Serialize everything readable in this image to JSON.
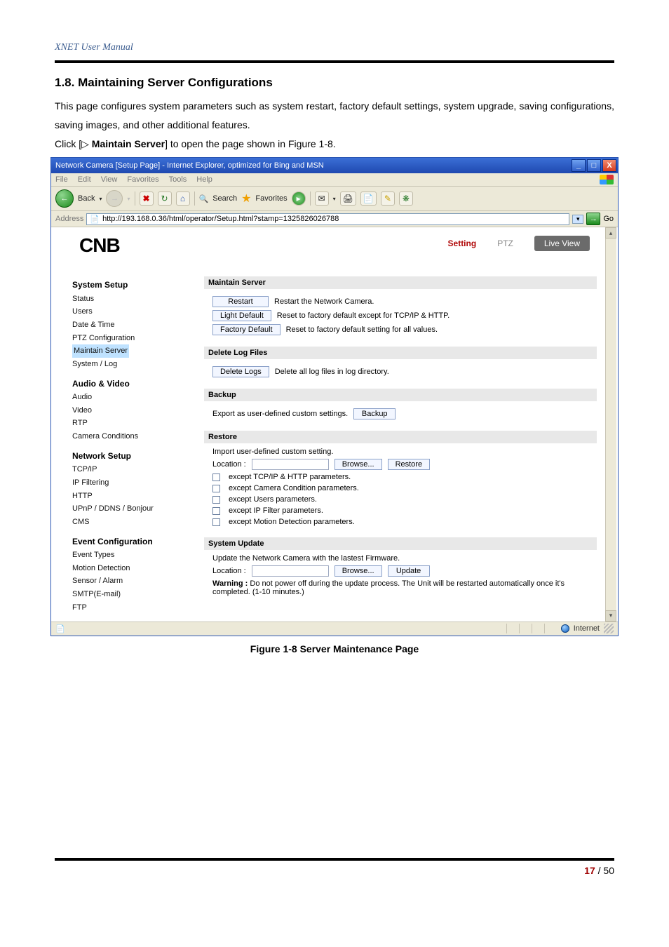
{
  "doc": {
    "manual_title": "XNET User Manual",
    "section_title": "1.8. Maintaining Server Configurations",
    "para1": "This page configures system parameters such as system restart, factory default settings, system upgrade, saving configurations, saving images, and other additional features.",
    "click_prefix": "Click [",
    "click_icon": "▷",
    "click_bold": " Maintain Server",
    "click_suffix": "] to open the page shown in Figure 1-8.",
    "figure_caption": "Figure 1-8 Server Maintenance Page",
    "page_current": "17",
    "page_sep": " / ",
    "page_total": "50"
  },
  "browser": {
    "title": "Network Camera [Setup Page] - Internet Explorer, optimized for Bing and MSN",
    "menu": {
      "file": "File",
      "edit": "Edit",
      "view": "View",
      "favorites": "Favorites",
      "tools": "Tools",
      "help": "Help"
    },
    "toolbar": {
      "back": "Back",
      "search": "Search",
      "favorites": "Favorites"
    },
    "address_label": "Address",
    "url": "http://193.168.0.36/html/operator/Setup.html?stamp=1325826026788",
    "go": "Go",
    "status_zone": "Internet"
  },
  "page": {
    "logo": "CNB",
    "tabs": {
      "setting": "Setting",
      "ptz": "PTZ",
      "live": "Live View"
    },
    "sidebar": {
      "g1": "System Setup",
      "g1_items": [
        "Status",
        "Users",
        "Date & Time",
        "PTZ Configuration",
        "Maintain Server",
        "System / Log"
      ],
      "g2": "Audio & Video",
      "g2_items": [
        "Audio",
        "Video",
        "RTP",
        "Camera Conditions"
      ],
      "g3": "Network Setup",
      "g3_items": [
        "TCP/IP",
        "IP Filtering",
        "HTTP",
        "UPnP / DDNS / Bonjour",
        "CMS"
      ],
      "g4": "Event Configuration",
      "g4_items": [
        "Event Types",
        "Motion Detection",
        "Sensor / Alarm",
        "SMTP(E-mail)",
        "FTP"
      ]
    },
    "maintain": {
      "head": "Maintain Server",
      "restart_btn": "Restart",
      "restart_txt": "Restart the Network Camera.",
      "light_btn": "Light Default",
      "light_txt": "Reset to factory default except for TCP/IP & HTTP.",
      "factory_btn": "Factory Default",
      "factory_txt": "Reset to factory default setting for all values."
    },
    "delete": {
      "head": "Delete Log Files",
      "btn": "Delete Logs",
      "txt": "Delete all log files in log directory."
    },
    "backup": {
      "head": "Backup",
      "txt": "Export as user-defined custom settings.",
      "btn": "Backup"
    },
    "restore": {
      "head": "Restore",
      "intro": "Import user-defined custom setting.",
      "loc": "Location :",
      "browse": "Browse...",
      "btn": "Restore",
      "chk1": "except TCP/IP & HTTP parameters.",
      "chk2": "except Camera Condition parameters.",
      "chk3": "except Users parameters.",
      "chk4": "except IP Filter parameters.",
      "chk5": "except Motion Detection parameters."
    },
    "update": {
      "head": "System Update",
      "intro": "Update the Network Camera with the lastest Firmware.",
      "loc": "Location :",
      "browse": "Browse...",
      "btn": "Update",
      "warn_label": "Warning : ",
      "warn_txt": "Do not power off during the update process. The Unit will be restarted automatically once it's completed. (1-10 minutes.)"
    }
  }
}
